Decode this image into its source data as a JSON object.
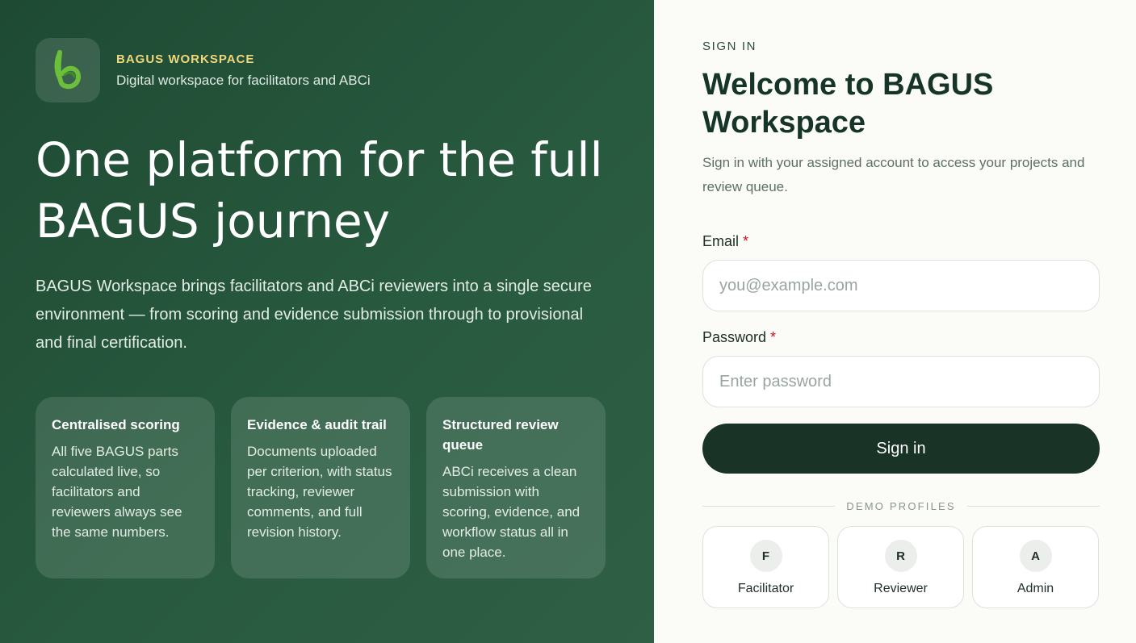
{
  "brand": {
    "name": "BAGUS WORKSPACE",
    "tagline": "Digital workspace for facilitators and ABCi",
    "logo_icon": "leaf-b-logo-icon",
    "logo_colors": [
      "#6cbf3a",
      "#3e8f2a"
    ]
  },
  "hero": {
    "headline": "One platform for the full BAGUS journey",
    "intro": "BAGUS Workspace brings facilitators and ABCi reviewers into a single secure environment — from scoring and evidence submission through to provisional and final certification."
  },
  "features": [
    {
      "title": "Centralised scoring",
      "body": "All five BAGUS parts calculated live, so facilitators and reviewers always see the same numbers."
    },
    {
      "title": "Evidence & audit trail",
      "body": "Documents uploaded per criterion, with status tracking, reviewer comments, and full revision history."
    },
    {
      "title": "Structured review queue",
      "body": "ABCi receives a clean submission with scoring, evidence, and workflow status all in one place."
    }
  ],
  "signin": {
    "eyebrow": "SIGN IN",
    "title": "Welcome to BAGUS Workspace",
    "subtitle": "Sign in with your assigned account to access your projects and review queue.",
    "email_label": "Email",
    "email_placeholder": "you@example.com",
    "email_value": "",
    "password_label": "Password",
    "password_placeholder": "Enter password",
    "password_value": "",
    "required_marker": "*",
    "button_label": "Sign in"
  },
  "demo_profiles": {
    "heading": "DEMO PROFILES",
    "items": [
      {
        "initial": "F",
        "label": "Facilitator"
      },
      {
        "initial": "R",
        "label": "Reviewer"
      },
      {
        "initial": "A",
        "label": "Admin"
      }
    ]
  },
  "colors": {
    "left_bg": "#24553b",
    "brand_accent": "#efd77c",
    "primary_button": "#1a3327",
    "required": "#c01a1a"
  }
}
